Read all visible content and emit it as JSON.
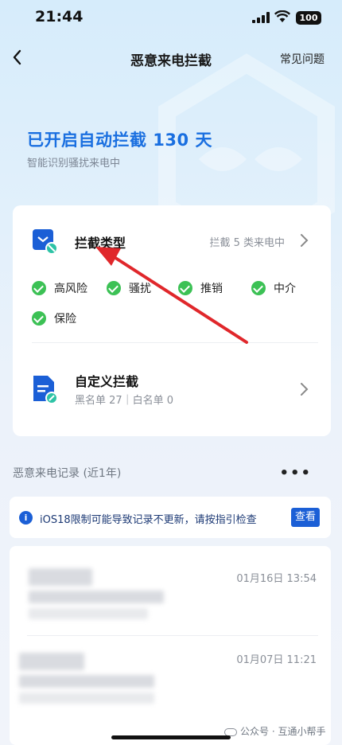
{
  "status": {
    "time": "21:44",
    "battery": "100"
  },
  "nav": {
    "title": "恶意来电拦截",
    "faq": "常见问题"
  },
  "hero": {
    "title": "已开启自动拦截 130 天",
    "subtitle": "智能识别骚扰来电中"
  },
  "block_type": {
    "title": "拦截类型",
    "summary": "拦截 5 类来电中",
    "icon": "shield-block-icon"
  },
  "tags": [
    "高风险",
    "骚扰",
    "推销",
    "中介",
    "保险"
  ],
  "custom_block": {
    "title": "自定义拦截",
    "detail": "黑名单 27｜白名单 0",
    "icon": "document-edit-icon"
  },
  "records": {
    "heading": "恶意来电记录 (近1年)",
    "notice": "iOS18限制可能导致记录不更新，请按指引检查",
    "notice_button": "查看",
    "items": [
      {
        "date": "01月16日 13:54"
      },
      {
        "date": "01月07日 11:21"
      }
    ]
  },
  "watermark": "公众号 · 互通小帮手",
  "colors": {
    "accent": "#1a6fe0",
    "check": "#3cc155",
    "annotation_arrow": "#e0272b"
  }
}
